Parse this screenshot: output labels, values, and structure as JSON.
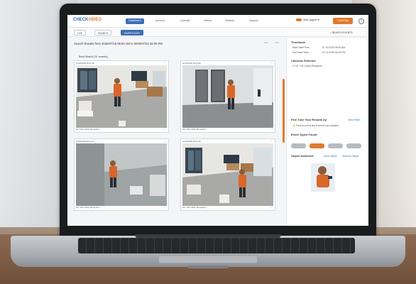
{
  "app": {
    "logo_prefix": "CHECK",
    "logo_suffix": "VIDEO",
    "nav": [
      "Dashboard",
      "Account",
      "Quantity",
      "History",
      "Network",
      "Support"
    ],
    "active_nav_index": 0,
    "user_text": "Stay logged in",
    "add_button_label": "+ Add New",
    "help_icon_label": "?"
  },
  "subbar": {
    "buttons": [
      "LIVE",
      "SEARCH",
      "INVESTIGATE"
    ],
    "active_index": 2,
    "search_label": "SEARCH EVENTS"
  },
  "results": {
    "title": "Search Results from 2025/07/15 06:00 AM to 2025/07/22 02:00 PM",
    "best_match": "Best Match (11 events)",
    "mini_left": "Sort",
    "mini_right": "Grid"
  },
  "cameras": [
    {
      "timestamp": "07/18/2025 06:11:08",
      "label": "HC 101 Lobby Reception",
      "scene": "lobby"
    },
    {
      "timestamp": "07/18/2025 06:13:32",
      "label": "HC 101 Lobby Reception",
      "scene": "elevator"
    },
    {
      "timestamp": "07/18/2025 06:21:12",
      "label": "HC 101 Lobby Reception",
      "scene": "hallway"
    },
    {
      "timestamp": "07/18/2025 06:24:40",
      "label": "HC 101 Lobby Reception",
      "scene": "lobby"
    }
  ],
  "sidebar": {
    "timeframe_title": "Timeframe",
    "start_label": "Start Date/Time",
    "start_value": "07.15.2025 06:00 AM",
    "end_label": "End Date/Time",
    "end_value": "07.22.2025 02:00 PM",
    "cameras_title": "Cameras Selected",
    "camera_item": "HC 101 Lobby Reception",
    "refine_title": "Fine Tune Your Results by:",
    "refine_link": "View Filters",
    "refine_hint": "Find an event clip to search by example",
    "event_types_title": "Event Types Found",
    "event_chips": 4,
    "active_chip": 1,
    "object_title": "Object Searched",
    "object_link1": "Save Object",
    "object_link2": "Remove Object"
  },
  "colors": {
    "brand_blue": "#3d6fb3",
    "accent_orange": "#e07a2e"
  }
}
